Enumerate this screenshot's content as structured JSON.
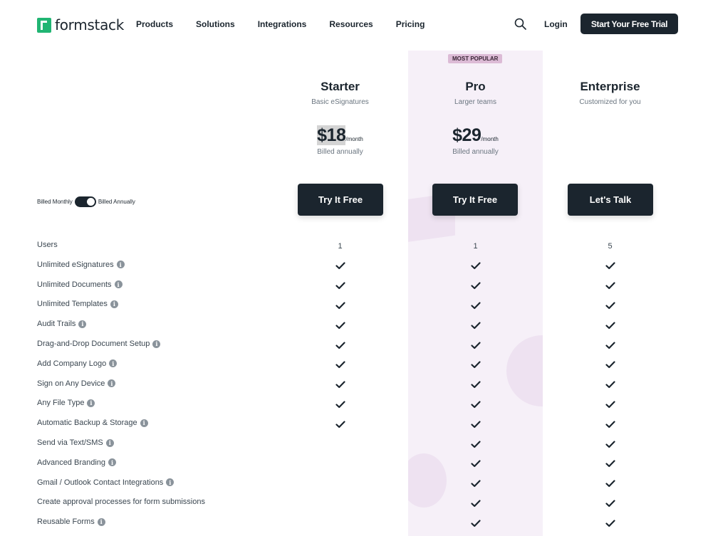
{
  "header": {
    "logo_text": "formstack",
    "nav": [
      "Products",
      "Solutions",
      "Integrations",
      "Resources",
      "Pricing"
    ],
    "login": "Login",
    "trial": "Start Your Free Trial"
  },
  "badge": "MOST POPULAR",
  "plans": [
    {
      "name": "Starter",
      "subtitle": "Basic eSignatures",
      "price": "$18",
      "per": "/month",
      "billed": "Billed annually",
      "cta": "Try It Free"
    },
    {
      "name": "Pro",
      "subtitle": "Larger teams",
      "price": "$29",
      "per": "/month",
      "billed": "Billed annually",
      "cta": "Try It Free"
    },
    {
      "name": "Enterprise",
      "subtitle": "Customized for you",
      "price": "",
      "per": "",
      "billed": "",
      "cta": "Let's Talk"
    }
  ],
  "billing_toggle": {
    "left": "Billed Monthly",
    "right": "Billed Annually",
    "state": "annually"
  },
  "features": [
    {
      "name": "Users",
      "info": false,
      "starter": "1",
      "pro": "1",
      "enterprise": "5"
    },
    {
      "name": "Unlimited eSignatures",
      "info": true,
      "starter": "check",
      "pro": "check",
      "enterprise": "check"
    },
    {
      "name": "Unlimited Documents",
      "info": true,
      "starter": "check",
      "pro": "check",
      "enterprise": "check"
    },
    {
      "name": "Unlimited Templates",
      "info": true,
      "starter": "check",
      "pro": "check",
      "enterprise": "check"
    },
    {
      "name": "Audit Trails",
      "info": true,
      "starter": "check",
      "pro": "check",
      "enterprise": "check"
    },
    {
      "name": "Drag-and-Drop Document Setup",
      "info": true,
      "starter": "check",
      "pro": "check",
      "enterprise": "check"
    },
    {
      "name": "Add Company Logo",
      "info": true,
      "starter": "check",
      "pro": "check",
      "enterprise": "check"
    },
    {
      "name": "Sign on Any Device",
      "info": true,
      "starter": "check",
      "pro": "check",
      "enterprise": "check"
    },
    {
      "name": "Any File Type",
      "info": true,
      "starter": "check",
      "pro": "check",
      "enterprise": "check"
    },
    {
      "name": "Automatic Backup & Storage",
      "info": true,
      "starter": "check",
      "pro": "check",
      "enterprise": "check"
    },
    {
      "name": "Send via Text/SMS",
      "info": true,
      "starter": "",
      "pro": "check",
      "enterprise": "check"
    },
    {
      "name": "Advanced Branding",
      "info": true,
      "starter": "",
      "pro": "check",
      "enterprise": "check"
    },
    {
      "name": "Gmail / Outlook Contact Integrations",
      "info": true,
      "starter": "",
      "pro": "check",
      "enterprise": "check"
    },
    {
      "name": "Create approval processes for form submissions",
      "info": false,
      "starter": "",
      "pro": "check",
      "enterprise": "check"
    },
    {
      "name": "Reusable Forms",
      "info": true,
      "starter": "",
      "pro": "check",
      "enterprise": "check"
    }
  ],
  "icons": {
    "search": "search-icon",
    "check": "check-icon",
    "info": "info-icon",
    "logo": "formstack-logo-icon"
  },
  "colors": {
    "brand_green": "#21b573",
    "dark": "#1b252e",
    "pro_column": "#f6f0f8",
    "badge": "#dcbbd6"
  }
}
